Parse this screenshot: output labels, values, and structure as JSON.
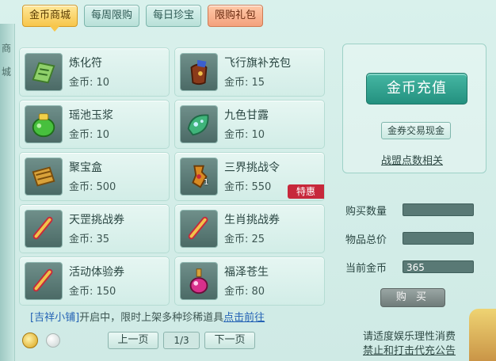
{
  "tabs": [
    {
      "label": "金币商城",
      "state": "active"
    },
    {
      "label": "每周限购",
      "state": "normal"
    },
    {
      "label": "每日珍宝",
      "state": "normal"
    },
    {
      "label": "限购礼包",
      "state": "highlight"
    }
  ],
  "left_edge": {
    "chars": [
      "商",
      "城"
    ]
  },
  "items": [
    {
      "name": "炼化符",
      "price": "金币: 10",
      "icon": "talisman-icon"
    },
    {
      "name": "飞行旗补充包",
      "price": "金币: 15",
      "icon": "flag-pack-icon"
    },
    {
      "name": "瑶池玉浆",
      "price": "金币: 10",
      "icon": "jade-jar-icon"
    },
    {
      "name": "九色甘露",
      "price": "金币: 10",
      "icon": "leaf-dew-icon"
    },
    {
      "name": "聚宝盒",
      "price": "金币: 500",
      "icon": "treasure-box-icon"
    },
    {
      "name": "三界挑战令",
      "price": "金币: 550",
      "icon": "challenge-token-icon",
      "qty": "1",
      "tag": "特惠"
    },
    {
      "name": "天罡挑战券",
      "price": "金币: 35",
      "icon": "scroll-icon"
    },
    {
      "name": "生肖挑战券",
      "price": "金币: 25",
      "icon": "scroll-icon"
    },
    {
      "name": "活动体验券",
      "price": "金币: 150",
      "icon": "scroll-icon"
    },
    {
      "name": "福泽苍生",
      "price": "金币: 80",
      "icon": "potion-bottle-icon"
    }
  ],
  "panel": {
    "recharge_label": "金币充值",
    "trade_label": "金券交易现金",
    "alliance_label": "战盟点数相关"
  },
  "purchase": {
    "qty_label": "购买数量",
    "qty_value": "",
    "total_label": "物品总价",
    "total_value": "",
    "gold_label": "当前金币",
    "gold_value": "365",
    "buy_label": "购 买"
  },
  "notice": {
    "shop_name": "[吉祥小铺]",
    "text": "开启中，限时上架多种珍稀道具",
    "link": "点击前往"
  },
  "pager": {
    "prev": "上一页",
    "page": "1/3",
    "next": "下一页"
  },
  "footer": {
    "line1": "请适度娱乐理性消费",
    "line2": "禁止和打击代充公告"
  },
  "colors": {
    "accent": "#23907f",
    "active_tab": "#f7c64b",
    "tag_red": "#c7283b",
    "link_blue": "#2563b5"
  }
}
